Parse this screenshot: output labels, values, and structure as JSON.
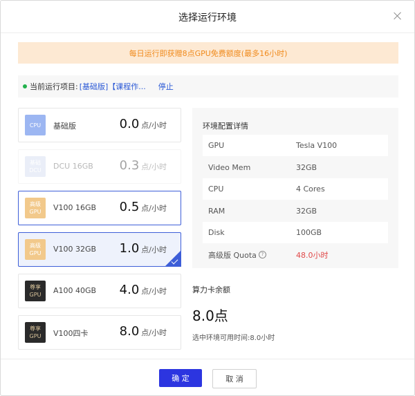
{
  "dialog": {
    "title": "选择运行环境",
    "banner": "每日运行即获赠8点GPU免费额度(最多16小时)",
    "status": {
      "label": "当前运行项目:",
      "project": "[基础版]【课程作...",
      "stop": "停止"
    }
  },
  "options": [
    {
      "chip_line1": "CPU",
      "chip_line2": "",
      "name": "基础版",
      "price": "0.0",
      "unit": "点/小时"
    },
    {
      "chip_line1": "基础",
      "chip_line2": "DCU",
      "name": "DCU 16GB",
      "price": "0.3",
      "unit": "点/小时"
    },
    {
      "chip_line1": "高级",
      "chip_line2": "GPU",
      "name": "V100 16GB",
      "price": "0.5",
      "unit": "点/小时"
    },
    {
      "chip_line1": "高级",
      "chip_line2": "GPU",
      "name": "V100 32GB",
      "price": "1.0",
      "unit": "点/小时"
    },
    {
      "chip_line1": "尊享",
      "chip_line2": "GPU",
      "name": "A100 40GB",
      "price": "4.0",
      "unit": "点/小时"
    },
    {
      "chip_line1": "尊享",
      "chip_line2": "GPU",
      "name": "V100四卡",
      "price": "8.0",
      "unit": "点/小时"
    }
  ],
  "details": {
    "title": "环境配置详情",
    "rows": [
      {
        "key": "GPU",
        "value": "Tesla V100"
      },
      {
        "key": "Video Mem",
        "value": "32GB"
      },
      {
        "key": "CPU",
        "value": "4 Cores"
      },
      {
        "key": "RAM",
        "value": "32GB"
      },
      {
        "key": "Disk",
        "value": "100GB"
      },
      {
        "key": "高级版 Quota",
        "value": "48.0小时"
      }
    ],
    "help_icon": "?"
  },
  "balance": {
    "label": "算力卡余额",
    "value": "8.0点",
    "note": "选中环境可用时间:8.0小时"
  },
  "footer": {
    "ok": "确 定",
    "cancel": "取 消"
  },
  "colors": {
    "accent": "#2c35e0",
    "banner_bg": "#fde9d3",
    "banner_text": "#f08a1c",
    "quota_red": "#e04848",
    "status_dot": "#22b14c"
  }
}
